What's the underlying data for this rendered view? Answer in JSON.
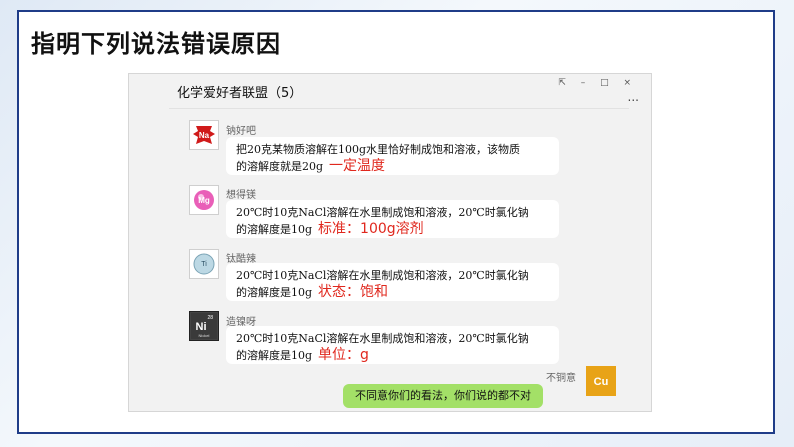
{
  "slide_title": "指明下列说法错误原因",
  "chat": {
    "title": "化学爱好者联盟（5）",
    "controls": "⇱ – □ ×",
    "more": "...",
    "messages": [
      {
        "name": "钠好吧",
        "avatar_text": "Na",
        "avatar_color": "#d01a1a",
        "line1": "把20克某物质溶解在100g水里恰好制成饱和溶液，该物质",
        "line2": "的溶解度就是20g",
        "annotation": "一定温度"
      },
      {
        "name": "想得镁",
        "avatar_text": "Mg",
        "avatar_color": "#e95fb8",
        "line1": "20℃时10克NaCl溶解在水里制成饱和溶液，20℃时氯化钠",
        "line2": "的溶解度是10g",
        "annotation": "标准：100g溶剂"
      },
      {
        "name": "钛酷辣",
        "avatar_text": "Ti",
        "avatar_color": "#8fb7c9",
        "line1": "20℃时10克NaCl溶解在水里制成饱和溶液，20℃时氯化钠",
        "line2": "的溶解度是10g",
        "annotation": "状态：饱和"
      },
      {
        "name": "造镍呀",
        "avatar_text": "Ni",
        "avatar_num": "28",
        "avatar_sub": "Nickel",
        "avatar_color": "#333333",
        "line1": "20℃时10克NaCl溶解在水里制成饱和溶液，20℃时氯化钠",
        "line2": "的溶解度是10g",
        "annotation": "单位：g"
      }
    ],
    "reply": {
      "name": "不铜意",
      "avatar_text": "Cu",
      "avatar_color": "#e8a317",
      "text": "不同意你们的看法，你们说的都不对"
    }
  }
}
